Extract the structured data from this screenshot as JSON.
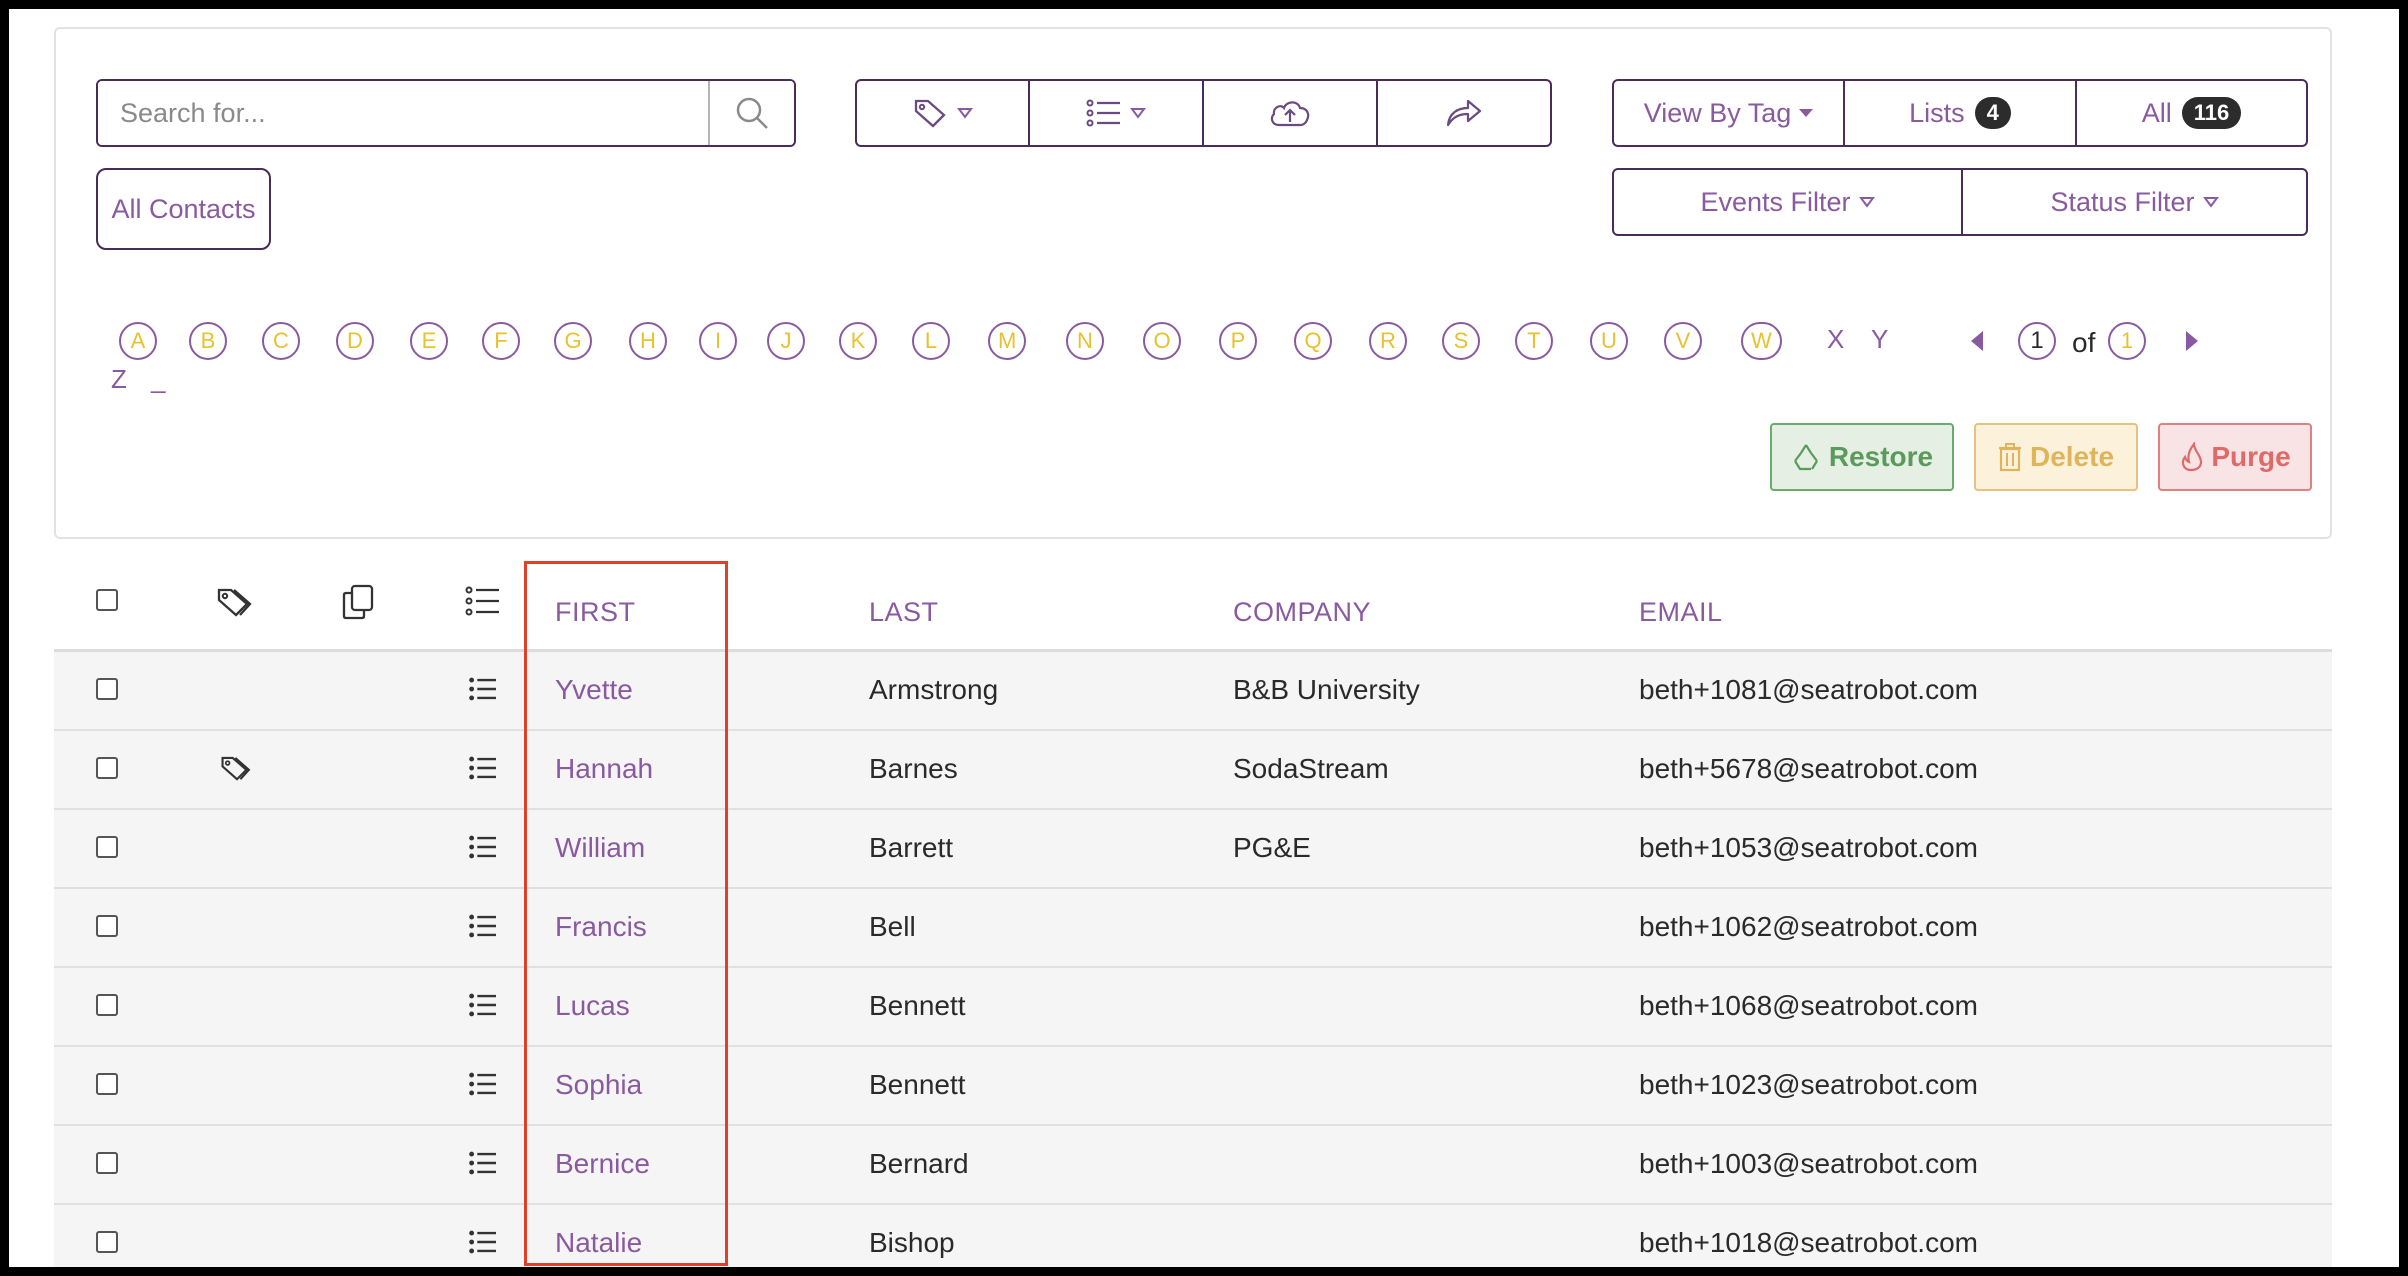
{
  "search": {
    "placeholder": "Search for..."
  },
  "toolbar": {
    "tag_icon": "tag-icon",
    "list_icon": "list-icon",
    "upload_icon": "cloud-upload-icon",
    "share_icon": "share-arrow-icon"
  },
  "view": {
    "view_by_tag": "View By Tag",
    "lists_label": "Lists",
    "lists_count": "4",
    "all_label": "All",
    "all_count": "116",
    "events_filter": "Events Filter",
    "status_filter": "Status Filter"
  },
  "all_contacts": "All Contacts",
  "alphabet": {
    "circled": [
      "A",
      "B",
      "C",
      "D",
      "E",
      "F",
      "G",
      "H",
      "I",
      "J",
      "K",
      "L",
      "M",
      "N",
      "O",
      "P",
      "Q",
      "R",
      "S",
      "T",
      "U",
      "V",
      "W"
    ],
    "plain": [
      "X",
      "Y",
      "Z",
      "_"
    ]
  },
  "pagination": {
    "current": "1",
    "of": "of",
    "total": "1"
  },
  "actions": {
    "restore": "Restore",
    "delete": "Delete",
    "purge": "Purge"
  },
  "colors": {
    "accent": "#8a5aa0",
    "letters": "#e8c22e",
    "restore": "#5a9a5a",
    "delete": "#e0b45a",
    "purge": "#e06a6a",
    "highlight": "#e0402a"
  },
  "table": {
    "headers": {
      "first": "FIRST",
      "last": "LAST",
      "company": "COMPANY",
      "email": "EMAIL"
    },
    "rows": [
      {
        "first": "Yvette",
        "last": "Armstrong",
        "company": "B&B University",
        "email": "beth+1081@seatrobot.com",
        "tagged": false
      },
      {
        "first": "Hannah",
        "last": "Barnes",
        "company": "SodaStream",
        "email": "beth+5678@seatrobot.com",
        "tagged": true
      },
      {
        "first": "William",
        "last": "Barrett",
        "company": "PG&E",
        "email": "beth+1053@seatrobot.com",
        "tagged": false
      },
      {
        "first": "Francis",
        "last": "Bell",
        "company": "",
        "email": "beth+1062@seatrobot.com",
        "tagged": false
      },
      {
        "first": "Lucas",
        "last": "Bennett",
        "company": "",
        "email": "beth+1068@seatrobot.com",
        "tagged": false
      },
      {
        "first": "Sophia",
        "last": "Bennett",
        "company": "",
        "email": "beth+1023@seatrobot.com",
        "tagged": false
      },
      {
        "first": "Bernice",
        "last": "Bernard",
        "company": "",
        "email": "beth+1003@seatrobot.com",
        "tagged": false
      },
      {
        "first": "Natalie",
        "last": "Bishop",
        "company": "",
        "email": "beth+1018@seatrobot.com",
        "tagged": false
      }
    ]
  }
}
